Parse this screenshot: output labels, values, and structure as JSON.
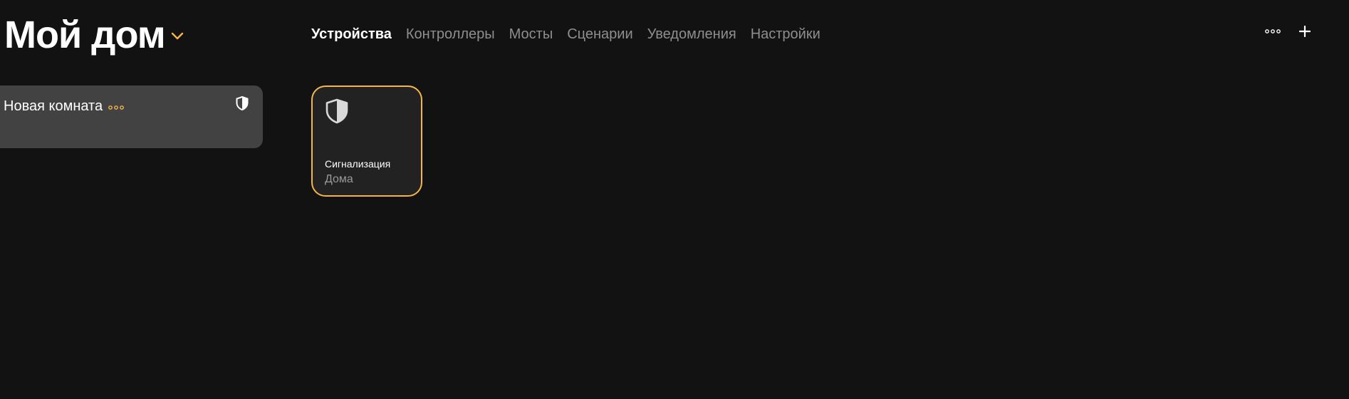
{
  "header": {
    "title": "Мой дом",
    "tabs": [
      {
        "label": "Устройства",
        "active": true
      },
      {
        "label": "Контроллеры",
        "active": false
      },
      {
        "label": "Мосты",
        "active": false
      },
      {
        "label": "Сценарии",
        "active": false
      },
      {
        "label": "Уведомления",
        "active": false
      },
      {
        "label": "Настройки",
        "active": false
      }
    ],
    "actions": {
      "more_icon": "more-dots-icon",
      "add_icon": "plus-icon"
    }
  },
  "room": {
    "name": "Новая комната",
    "icon": "shield-icon"
  },
  "device": {
    "name": "Сигнализация",
    "status": "Дома",
    "icon": "shield-icon"
  },
  "colors": {
    "background": "#121212",
    "accent": "#f5b54a",
    "room_card": "#424242",
    "tile": "#222222",
    "inactive_text": "#8e8e8e"
  }
}
